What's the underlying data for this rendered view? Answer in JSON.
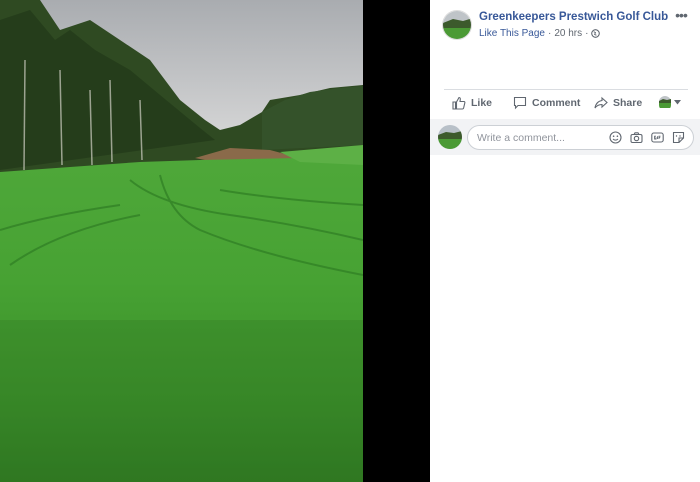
{
  "post": {
    "page_name": "Greenkeepers Prestwich Golf Club",
    "like_page": "Like This Page",
    "separator": "·",
    "time": "20 hrs",
    "separator2": "·",
    "more": "•••"
  },
  "photo": {
    "description_icon": "golf-course-photo"
  },
  "actions": {
    "like": "Like",
    "comment": "Comment",
    "share": "Share"
  },
  "comment": {
    "placeholder": "Write a comment..."
  },
  "colors": {
    "link": "#385898",
    "meta": "#606770",
    "grass": "#3f9a2e",
    "sky": "#c9cbcd"
  }
}
